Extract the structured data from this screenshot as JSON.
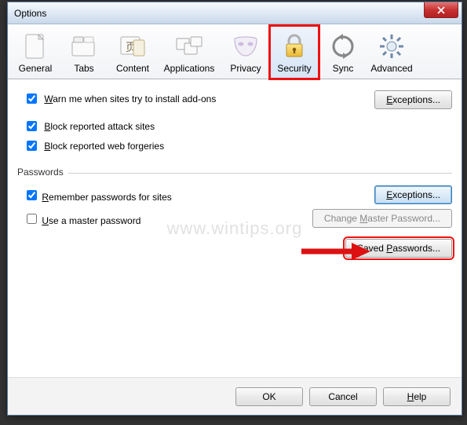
{
  "window": {
    "title": "Options"
  },
  "toolbar": {
    "items": [
      {
        "label": "General"
      },
      {
        "label": "Tabs"
      },
      {
        "label": "Content"
      },
      {
        "label": "Applications"
      },
      {
        "label": "Privacy"
      },
      {
        "label": "Security"
      },
      {
        "label": "Sync"
      },
      {
        "label": "Advanced"
      }
    ],
    "selected_index": 5
  },
  "security": {
    "warn_addons_label": "Warn me when sites try to install add-ons",
    "warn_addons_checked": true,
    "block_attack_label": "Block reported attack sites",
    "block_attack_checked": true,
    "block_forgeries_label": "Block reported web forgeries",
    "block_forgeries_checked": true,
    "exceptions_label": "Exceptions..."
  },
  "passwords": {
    "group_title": "Passwords",
    "remember_label": "Remember passwords for sites",
    "remember_checked": true,
    "master_label": "Use a master password",
    "master_checked": false,
    "exceptions_label": "Exceptions...",
    "change_master_label": "Change Master Password...",
    "saved_label": "Saved Passwords..."
  },
  "dialog_buttons": {
    "ok": "OK",
    "cancel": "Cancel",
    "help": "Help"
  },
  "watermark": "www.wintips.org"
}
